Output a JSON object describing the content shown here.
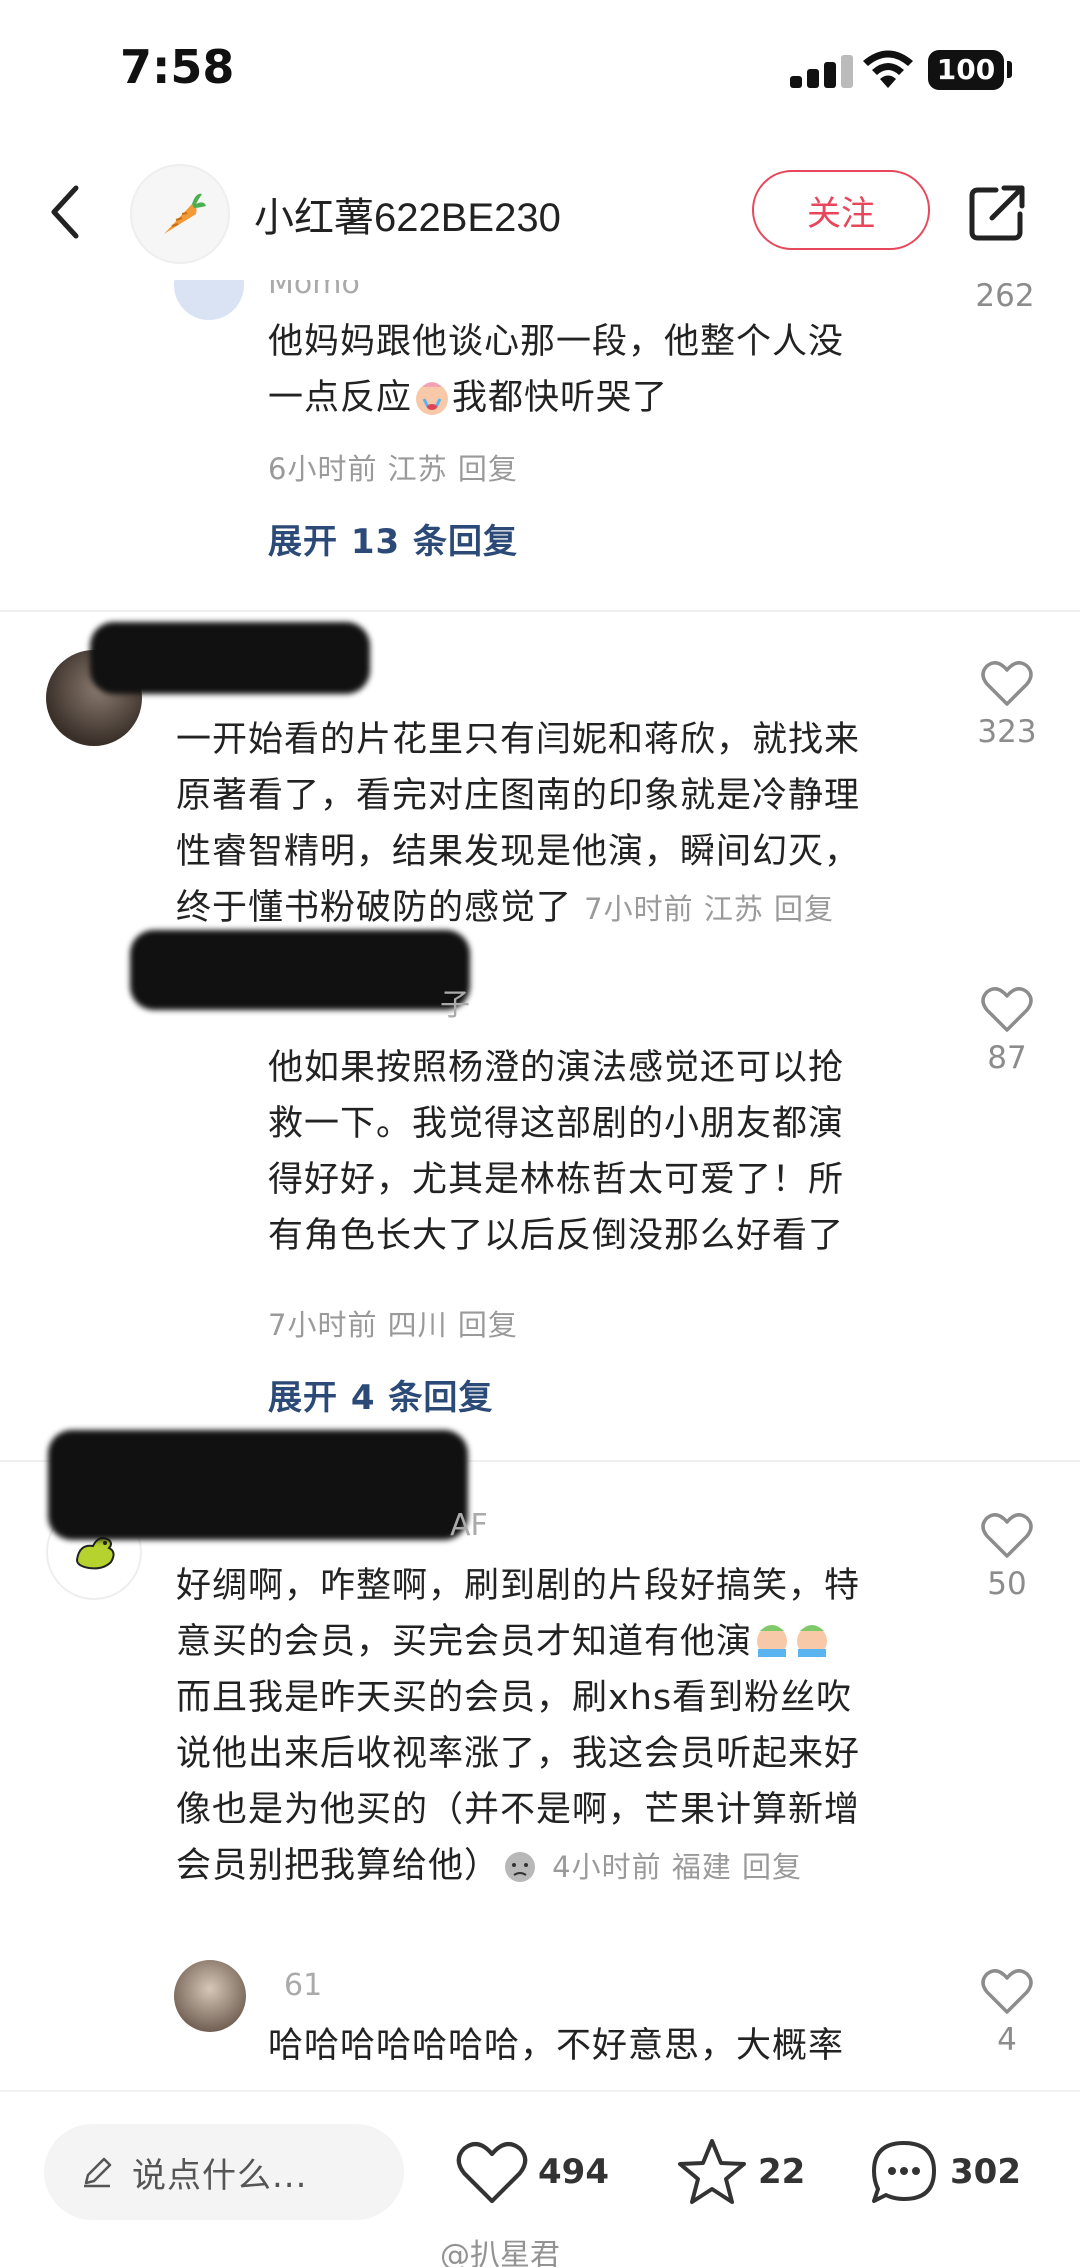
{
  "status": {
    "time": "7:58",
    "battery": "100"
  },
  "header": {
    "name": "小红薯622BE230",
    "follow_label": "关注"
  },
  "comments": [
    {
      "partial_name": "Momo",
      "lines": [
        "他妈妈跟他谈心那一段，他整个人没",
        "一点反应",
        "我都快听哭了"
      ],
      "meta": "6小时前  江苏  回复",
      "likes": "262",
      "expand": "展开 13 条回复"
    },
    {
      "lines": [
        "一开始看的片花里只有闫妮和蒋欣，就找来",
        "原著看了，看完对庄图南的印象就是冷静理",
        "性睿智精明，结果发现是他演，瞬间幻灭，",
        "终于懂书粉破防的感觉了"
      ],
      "meta": "7小时前  江苏  回复",
      "likes": "323"
    },
    {
      "partial_name": "子",
      "lines": [
        "他如果按照杨澄的演法感觉还可以抢",
        "救一下。我觉得这部剧的小朋友都演",
        "得好好，尤其是林栋哲太可爱了！所",
        "有角色长大了以后反倒没那么好看了"
      ],
      "meta": "7小时前  四川  回复",
      "likes": "87",
      "expand": "展开 4 条回复"
    },
    {
      "partial_name": "AF",
      "lines": [
        "好绸啊，咋整啊，刷到剧的片段好搞笑，特",
        "意买的会员，买完会员才知道有他演",
        "而且我是昨天买的会员，刷xhs看到粉丝吹",
        "说他出来后收视率涨了，我这会员听起来好",
        "像也是为他买的（并不是啊，芒果计算新增",
        "会员别把我算给他）"
      ],
      "meta": "4小时前  福建  回复",
      "likes": "50"
    },
    {
      "partial_name": "61",
      "lines": [
        "哈哈哈哈哈哈哈，不好意思，大概率"
      ],
      "likes": "4"
    }
  ],
  "bottom": {
    "placeholder": "说点什么...",
    "likes": "494",
    "stars": "22",
    "comments": "302"
  },
  "watermark": "@扒星君",
  "colors": {
    "accent": "#e8475b",
    "link": "#2c4a78",
    "meta": "#9a9a9a"
  }
}
